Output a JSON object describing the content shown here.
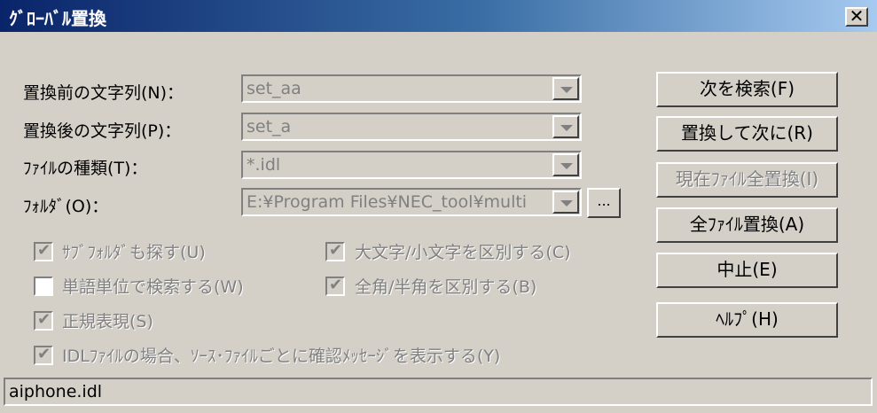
{
  "window": {
    "title": "ｸﾞﾛｰﾊﾞﾙ置換",
    "close_glyph": "✕"
  },
  "fields": {
    "find_label": "置換前の文字列(N)：",
    "find_value": "set_aa",
    "replace_label": "置換後の文字列(P)：",
    "replace_value": "set_a",
    "filetype_label": "ﾌｧｲﾙの種類(T)：",
    "filetype_value": "*.idl",
    "folder_label": "ﾌｫﾙﾀﾞ(O)：",
    "folder_value": "E:¥Program Files¥NEC_tool¥multi",
    "browse_label": "..."
  },
  "buttons": {
    "find_next": "次を検索(F)",
    "replace_next": "置換して次に(R)",
    "replace_all_current": "現在ﾌｧｲﾙ全置換(I)",
    "replace_all_files": "全ﾌｧｲﾙ置換(A)",
    "cancel": "中止(E)",
    "help": "ﾍﾙﾌﾟ(H)"
  },
  "options": {
    "subfolders": {
      "label": "ｻﾌﾞﾌｫﾙﾀﾞも探す(U)",
      "checked": true
    },
    "match_case": {
      "label": "大文字/小文字を区別する(C)",
      "checked": true
    },
    "whole_word": {
      "label": "単語単位で検索する(W)",
      "checked": false
    },
    "match_width": {
      "label": "全角/半角を区別する(B)",
      "checked": true
    },
    "regex": {
      "label": "正規表現(S)",
      "checked": true
    },
    "confirm_idl": {
      "label": "IDLﾌｧｲﾙの場合、ｿｰｽ･ﾌｧｲﾙごとに確認ﾒｯｾｰｼﾞを表示する(Y)",
      "checked": true
    }
  },
  "status": {
    "text": "aiphone.idl"
  }
}
